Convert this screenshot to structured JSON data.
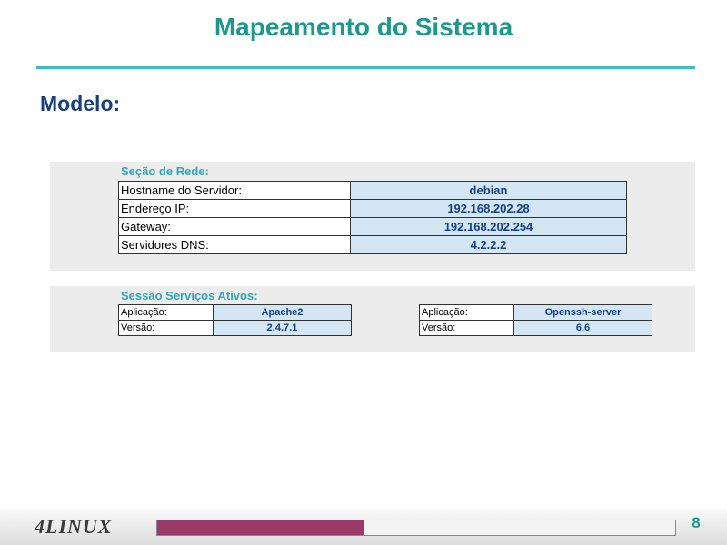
{
  "slide": {
    "title": "Mapeamento do Sistema",
    "subtitle": "Modelo:"
  },
  "network_section": {
    "label": "Seção de Rede:",
    "rows": [
      {
        "key": "Hostname do Servidor:",
        "value": "debian"
      },
      {
        "key": "Endereço IP:",
        "value": "192.168.202.28"
      },
      {
        "key": "Gateway:",
        "value": "192.168.202.254"
      },
      {
        "key": "Servidores DNS:",
        "value": "4.2.2.2"
      }
    ]
  },
  "services_section": {
    "label": "Sessão Serviços Ativos:",
    "services": [
      {
        "app_label": "Aplicação:",
        "app": "Apache2",
        "version_label": "Versão:",
        "version": "2.4.7.1"
      },
      {
        "app_label": "Aplicação:",
        "app": "Openssh-server",
        "version_label": "Versão:",
        "version": "6.6"
      }
    ]
  },
  "footer": {
    "logo": "4LINUX",
    "page_number": "8",
    "progress_fraction": 0.4,
    "progress_color": "#9a3a66"
  },
  "colors": {
    "title": "#1a9a8c",
    "subtitle": "#173f86",
    "section_label": "#31a6b8",
    "value_cell_bg": "#d3e6f4",
    "rule": "#3bbdc8"
  }
}
